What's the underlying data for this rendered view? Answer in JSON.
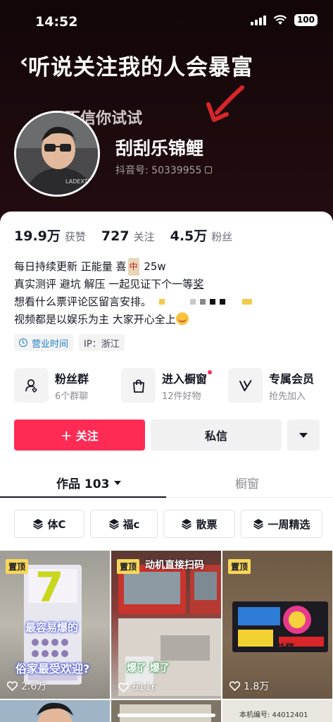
{
  "status_bar": {
    "time": "14:52",
    "battery": "100"
  },
  "banner": {
    "headline": "听说关注我的人会暴富",
    "subline": "不信你试试"
  },
  "profile": {
    "nickname": "刮刮乐锦鲤",
    "douyin_id": "抖音号: 50339955"
  },
  "stats": [
    {
      "value": "19.9万",
      "label": "获赞"
    },
    {
      "value": "727",
      "label": "关注"
    },
    {
      "value": "4.5万",
      "label": "粉丝"
    }
  ],
  "bio": {
    "line1_a": "每日持续更新   正能量          喜",
    "line1_tile": "中",
    "line1_b": " 25w",
    "line2_a": "真实测评    避坑  解压   一起见证下个一等",
    "line2_u": "奖",
    "line3": "想看什么票评论区留言安排。",
    "line4": "视频都是以娱乐为主 大家开心全上"
  },
  "tags": {
    "hours": "营业时间",
    "ip": "IP：浙江"
  },
  "services": [
    {
      "title": "粉丝群",
      "sub": "6个群聊",
      "icon": "fans-group-icon"
    },
    {
      "title": "进入橱窗",
      "sub": "12件好物",
      "icon": "shopping-bag-icon"
    },
    {
      "title": "专属会员",
      "sub": "抢先加入",
      "icon": "vip-icon"
    }
  ],
  "actions": {
    "follow": "＋ 关注",
    "message": "私信"
  },
  "tabs": {
    "works": "作品 103",
    "showcase": "橱窗"
  },
  "collections": [
    "体C",
    "福c",
    "散票",
    "一周精选"
  ],
  "videos": [
    {
      "badge": "置顶",
      "likes": "2.6万",
      "text_a": "最容易爆的",
      "text_b": "俗家最受欢迎?"
    },
    {
      "badge": "置顶",
      "likes": "6116",
      "text_a": "动机直接扫码",
      "text_b": "爆了 爆了"
    },
    {
      "badge": "置顶",
      "likes": "1.8万",
      "text_a": "兑奖"
    }
  ],
  "row2": {
    "text": "本机编号: 44012401"
  },
  "colors": {
    "accent": "#fe2c55",
    "pin": "#f7d65a",
    "header_bg": "#1c0a0d"
  }
}
